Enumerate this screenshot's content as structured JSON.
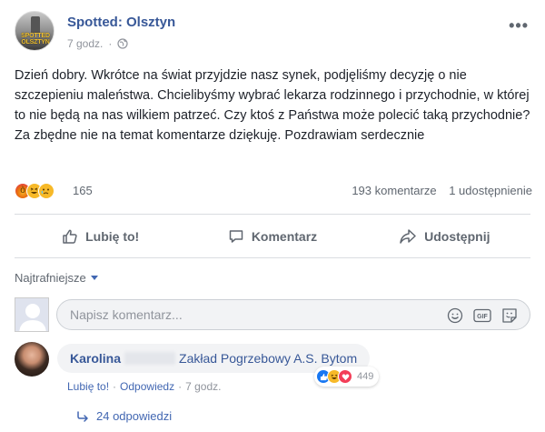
{
  "post": {
    "page_name": "Spotted: Olsztyn",
    "avatar_text": "SPOTTED OLSZTYN",
    "time": "7 godz.",
    "privacy_icon": "globe-icon",
    "more_icon": "more-options-icon",
    "more_label": "•••",
    "text": "Dzień dobry. Wkrótce na świat przyjdzie nasz synek, podjęliśmy decyzję o nie szczepieniu maleństwa. Chcielibyśmy wybrać lekarza rodzinnego i przychodnie, w której to nie będą na nas wilkiem patrzeć. Czy ktoś z Państwa może polecić taką przychodnie? Za zbędne nie na temat komentarze dziękuję. Pozdrawiam serdecznie"
  },
  "reactions": {
    "types": [
      "angry",
      "haha",
      "sad"
    ],
    "count": "165",
    "comments": "193 komentarze",
    "shares": "1 udostępnienie"
  },
  "actions": [
    {
      "label": "Lubię to!",
      "icon": "thumbs-up-icon"
    },
    {
      "label": "Komentarz",
      "icon": "comment-icon"
    },
    {
      "label": "Udostępnij",
      "icon": "share-icon"
    }
  ],
  "sort": {
    "label": "Najtrafniejsze"
  },
  "composer": {
    "placeholder": "Napisz komentarz...",
    "icons": [
      "emoji-icon",
      "gif-icon",
      "sticker-icon"
    ],
    "gif_label": "GIF"
  },
  "comment": {
    "author": "Karolina",
    "text": "Zakład Pogrzebowy A.S. Bytom",
    "reaction_types": [
      "like",
      "haha",
      "love"
    ],
    "reaction_count": "449",
    "like_label": "Lubię to!",
    "reply_label": "Odpowiedz",
    "time": "7 godz."
  },
  "replies": {
    "label": "24 odpowiedzi"
  },
  "colors": {
    "link": "#385898",
    "accent": "#4267b2",
    "muted": "#606770",
    "divider": "#dadde1"
  }
}
